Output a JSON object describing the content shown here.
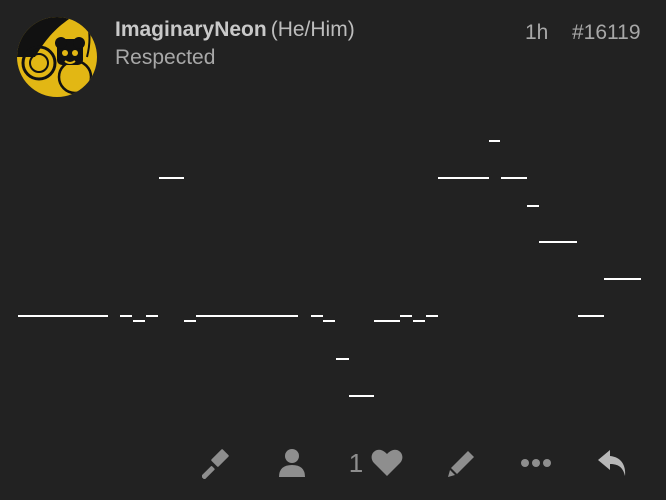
{
  "post": {
    "username": "ImaginaryNeon",
    "pronouns": "(He/Him)",
    "user_title": "Respected",
    "time_ago": "1h",
    "post_number": "#16119"
  },
  "actions": {
    "like_count": "1",
    "icons": [
      "gavel-icon",
      "user-icon",
      "heart-icon",
      "pencil-icon",
      "more-icon",
      "reply-icon"
    ]
  },
  "colors": {
    "background": "#222222",
    "icon": "#8e8e8e",
    "text": "#bdbdbd",
    "avatar_yellow": "#e2b714"
  }
}
